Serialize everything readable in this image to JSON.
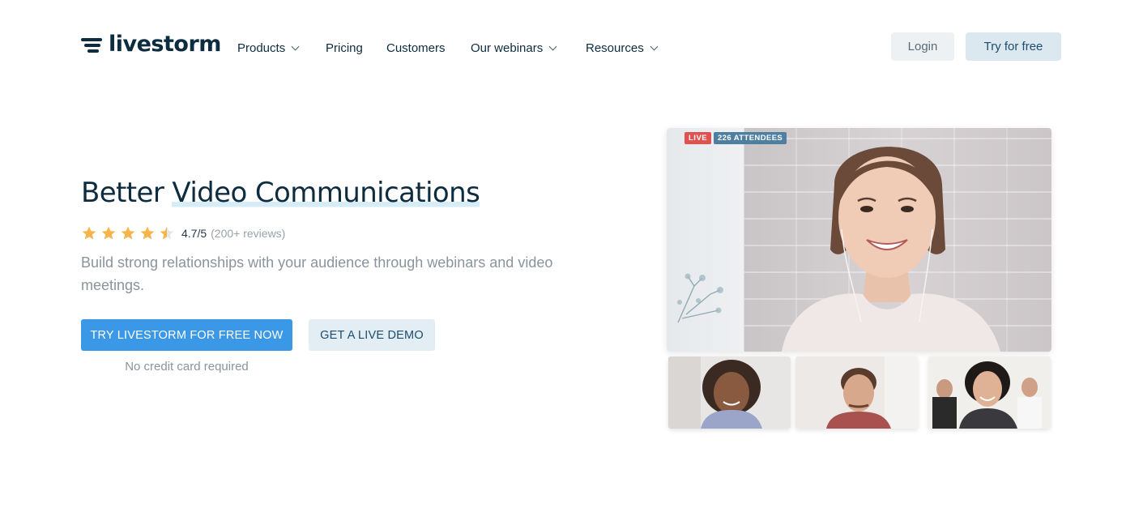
{
  "header": {
    "logo_text": "livestorm",
    "nav": [
      {
        "label": "Products",
        "has_dropdown": true
      },
      {
        "label": "Pricing",
        "has_dropdown": false
      },
      {
        "label": "Customers",
        "has_dropdown": false
      },
      {
        "label": "Our webinars",
        "has_dropdown": true
      },
      {
        "label": "Resources",
        "has_dropdown": true
      }
    ],
    "login_label": "Login",
    "try_label": "Try for free"
  },
  "hero": {
    "title_plain": "Better ",
    "title_highlight": "Video Communications",
    "rating": {
      "stars": 4.5,
      "score": "4.7/5",
      "reviews": "(200+ reviews)"
    },
    "subtitle": "Build strong relationships with your audience through webinars and video meetings.",
    "primary_cta": "TRY LIVESTORM FOR FREE NOW",
    "secondary_cta": "GET A LIVE DEMO",
    "note": "No credit card required"
  },
  "video": {
    "live_badge": "LIVE",
    "attendees_badge": "226 ATTENDEES"
  },
  "colors": {
    "brand_dark": "#0d2c40",
    "primary": "#3a98e6",
    "star": "#f5b54a",
    "live": "#e0524f",
    "attendees": "#4f7fa0"
  },
  "icons": [
    "logo-mark-icon",
    "chevron-down-icon",
    "star-icon",
    "half-star-icon"
  ]
}
